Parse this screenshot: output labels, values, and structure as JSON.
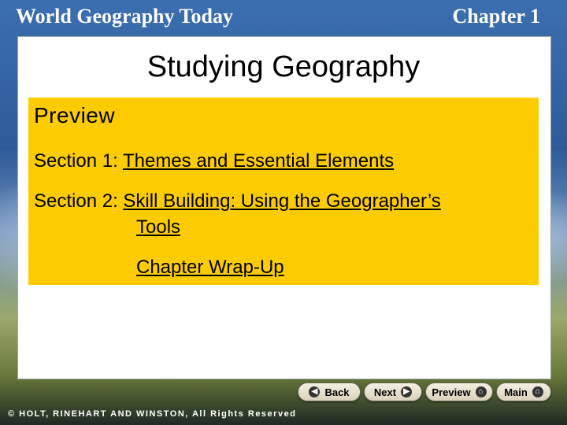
{
  "header": {
    "left_title": "World Geography Today",
    "right_title": "Chapter 1"
  },
  "slide": {
    "title": "Studying Geography",
    "preview_heading": "Preview",
    "section1_prefix": "Section 1:",
    "section1_link": "Themes and Essential Elements",
    "section2_prefix": "Section 2:",
    "section2_link_line1": "Skill Building: Using the Geographer’s",
    "section2_link_line2": "Tools",
    "wrapup_link": "Chapter Wrap-Up"
  },
  "nav": {
    "back": "Back",
    "next": "Next",
    "preview": "Preview",
    "main": "Main"
  },
  "icons": {
    "back": "chevron-left-icon",
    "next": "chevron-right-icon",
    "preview": "home-icon",
    "main": "home-icon"
  },
  "footer": {
    "copyright": "© HOLT, RINEHART AND WINSTON, All Rights Reserved"
  },
  "colors": {
    "preview_box": "#fccc00",
    "panel": "#ffffff",
    "header_text": "#ffffff"
  }
}
